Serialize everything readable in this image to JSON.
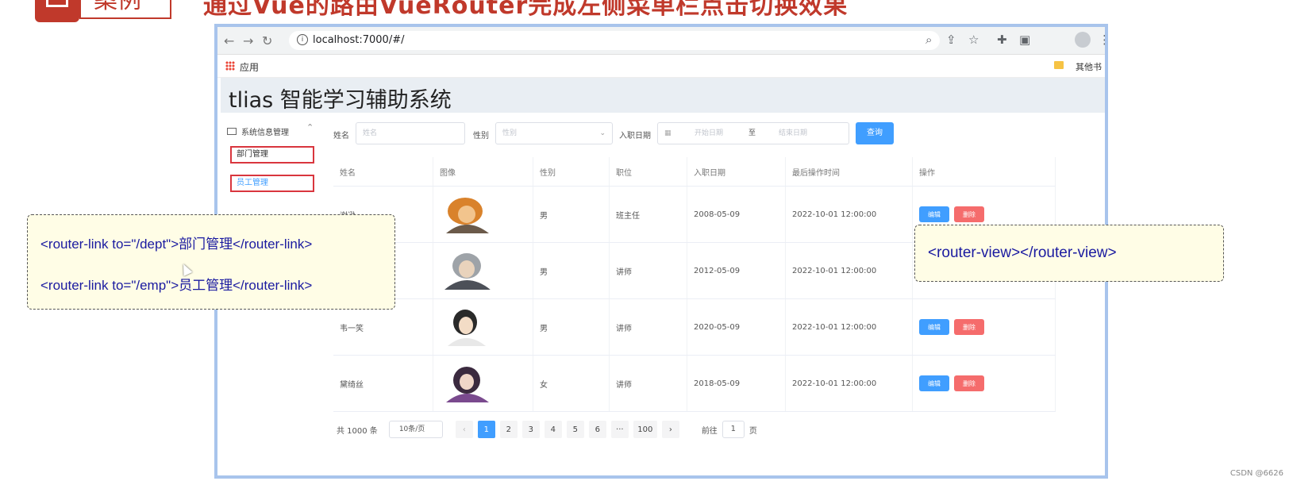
{
  "slide": {
    "badge_label": "案例",
    "title": "通过Vue的路由VueRouter完成左侧菜单栏点击切换效果"
  },
  "browser": {
    "url": "localhost:7000/#/",
    "bookmarks_apps": "应用",
    "bookmarks_other": "其他书"
  },
  "app": {
    "title": "tlias 智能学习辅助系统",
    "menu": {
      "group": "系统信息管理",
      "items": [
        "部门管理",
        "员工管理"
      ]
    },
    "search": {
      "name_label": "姓名",
      "name_placeholder": "姓名",
      "gender_label": "性别",
      "gender_placeholder": "性别",
      "date_label": "入职日期",
      "start_placeholder": "开始日期",
      "to": "至",
      "end_placeholder": "结束日期",
      "query_button": "查询"
    },
    "table": {
      "headers": [
        "姓名",
        "图像",
        "性别",
        "职位",
        "入职日期",
        "最后操作时间",
        "操作"
      ],
      "rows": [
        {
          "name": "谢逊",
          "gender": "男",
          "job": "班主任",
          "entry": "2008-05-09",
          "updated": "2022-10-01 12:00:00"
        },
        {
          "name": "",
          "gender": "男",
          "job": "讲师",
          "entry": "2012-05-09",
          "updated": "2022-10-01 12:00:00"
        },
        {
          "name": "韦一笑",
          "gender": "男",
          "job": "讲师",
          "entry": "2020-05-09",
          "updated": "2022-10-01 12:00:00"
        },
        {
          "name": "黛绮丝",
          "gender": "女",
          "job": "讲师",
          "entry": "2018-05-09",
          "updated": "2022-10-01 12:00:00"
        }
      ],
      "edit_label": "编辑",
      "delete_label": "删除"
    },
    "pagination": {
      "total": "共 1000 条",
      "page_size": "10条/页",
      "pages": [
        "1",
        "2",
        "3",
        "4",
        "5",
        "6",
        "···",
        "100"
      ],
      "current_page": "1",
      "goto_label": "前往",
      "goto_value": "1",
      "goto_suffix": "页"
    }
  },
  "annotations": {
    "left": [
      "<router-link to=\"/dept\">部门管理</router-link>",
      "<router-link to=\"/emp\">员工管理</router-link>"
    ],
    "right": "<router-view></router-view>"
  },
  "watermark": "CSDN @6626",
  "colors": {
    "primary": "#409eff",
    "danger": "#f56c6c",
    "annotation_text": "#1a1aa0",
    "slide_accent": "#c0392b"
  }
}
